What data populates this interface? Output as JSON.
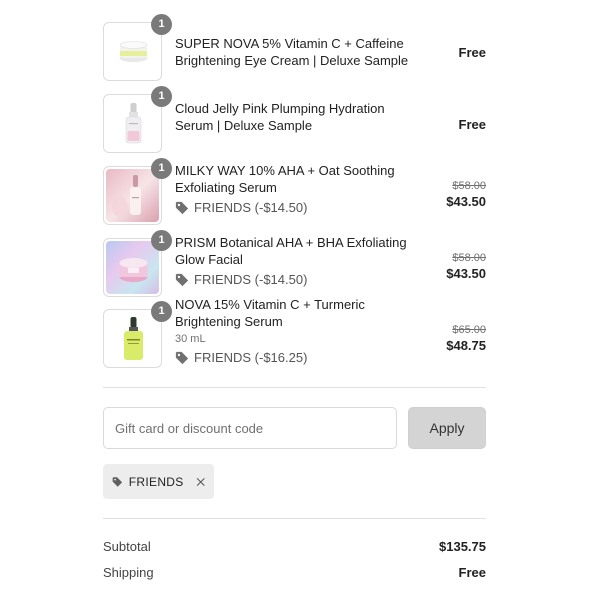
{
  "items": [
    {
      "name": "SUPER NOVA 5% Vitamin C + Caffeine Brightening Eye Cream | Deluxe Sample",
      "quantity": "1",
      "price": "Free",
      "thumbnail": "eye-cream-jar-thumbnail"
    },
    {
      "name": "Cloud Jelly Pink Plumping Hydration Serum | Deluxe Sample",
      "quantity": "1",
      "price": "Free",
      "thumbnail": "serum-dropper-bottle-thumbnail"
    },
    {
      "name": "MILKY WAY 10% AHA + Oat Soothing Exfoliating Serum",
      "quantity": "1",
      "discount": "FRIENDS (-$14.50)",
      "original_price": "$58.00",
      "price": "$43.50",
      "thumbnail": "pink-serum-bottle-thumbnail"
    },
    {
      "name": "PRISM Botanical AHA + BHA Exfoliating Glow Facial",
      "quantity": "1",
      "discount": "FRIENDS (-$14.50)",
      "original_price": "$58.00",
      "price": "$43.50",
      "thumbnail": "iridescent-jar-thumbnail"
    },
    {
      "name": "NOVA 15% Vitamin C + Turmeric Brightening Serum",
      "quantity": "1",
      "variant": "30 mL",
      "discount": "FRIENDS (-$16.25)",
      "original_price": "$65.00",
      "price": "$48.75",
      "thumbnail": "yellow-serum-bottle-thumbnail"
    }
  ],
  "discount_form": {
    "placeholder": "Gift card or discount code",
    "value": "",
    "apply_label": "Apply"
  },
  "applied_code": {
    "label": "FRIENDS",
    "icon": "tag-icon",
    "remove_icon": "close-icon"
  },
  "summary": {
    "subtotal_label": "Subtotal",
    "subtotal_value": "$135.75",
    "shipping_label": "Shipping",
    "shipping_value": "Free"
  },
  "colors": {
    "badge": "#7a7a7a",
    "apply_button": "#d4d4d4",
    "chip_bg": "#ededed",
    "divider": "#e0e0e0"
  }
}
